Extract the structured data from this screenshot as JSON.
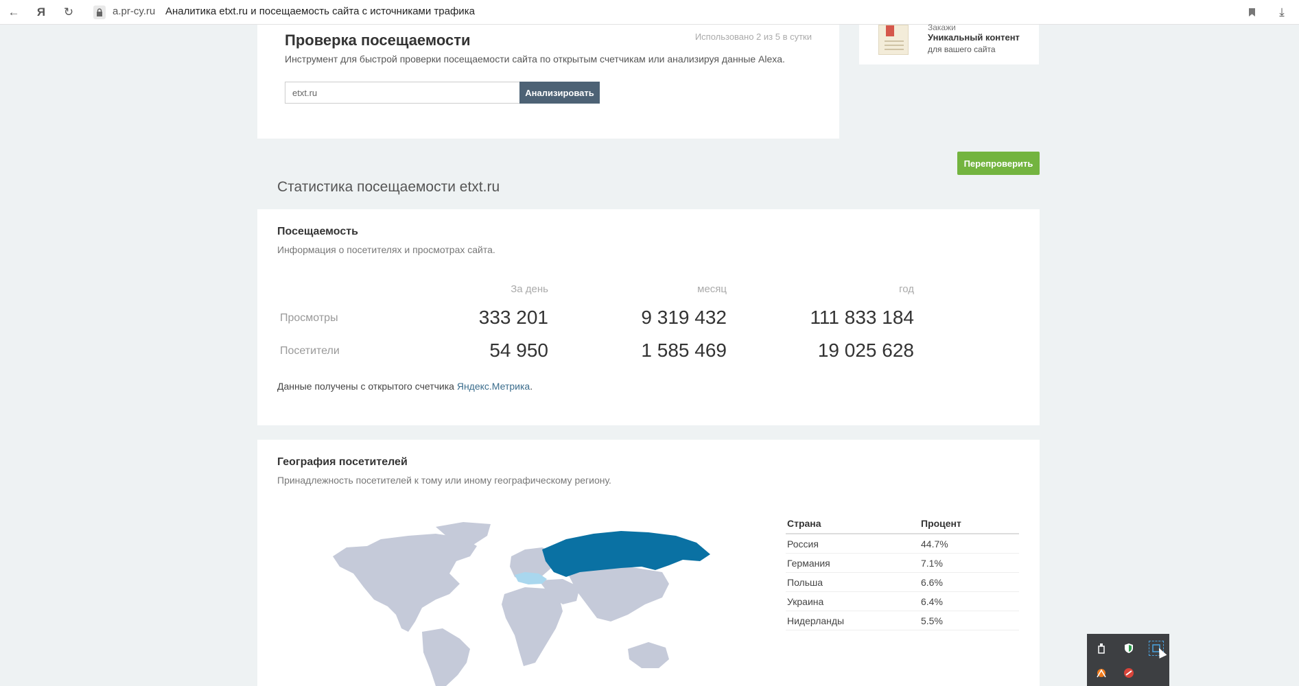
{
  "browser": {
    "domain": "a.pr-cy.ru",
    "page_title": "Аналитика etxt.ru и посещаемость сайта с источниками трафика",
    "yandex_glyph": "Я"
  },
  "check": {
    "title": "Проверка посещаемости",
    "usage": "Использовано 2 из 5 в сутки",
    "description": "Инструмент для быстрой проверки посещаемости сайта по открытым счетчикам или анализируя данные Alexa.",
    "input_value": "etxt.ru",
    "analyze_label": "Анализировать"
  },
  "ad": {
    "order_label": "Закажи",
    "bold_label": "Уникальный контент",
    "sub_label": "для вашего сайта"
  },
  "recheck_label": "Перепроверить",
  "stats_title": "Статистика посещаемости etxt.ru",
  "traffic": {
    "title": "Посещаемость",
    "subtitle": "Информация о посетителях и просмотрах сайта.",
    "columns": [
      "За день",
      "месяц",
      "год"
    ],
    "rows": [
      {
        "label": "Просмотры",
        "values": [
          "333 201",
          "9 319 432",
          "111 833 184"
        ]
      },
      {
        "label": "Посетители",
        "values": [
          "54 950",
          "1 585 469",
          "19 025 628"
        ]
      }
    ],
    "source_prefix": "Данные получены с открытого счетчика ",
    "source_link": "Яндекс.Метрика",
    "source_suffix": "."
  },
  "geo": {
    "title": "География посетителей",
    "subtitle": "Принадлежность посетителей к тому или иному географическому региону.",
    "table_headers": [
      "Страна",
      "Процент"
    ],
    "rows": [
      {
        "country": "Россия",
        "percent": "44.7%"
      },
      {
        "country": "Германия",
        "percent": "7.1%"
      },
      {
        "country": "Польша",
        "percent": "6.6%"
      },
      {
        "country": "Украина",
        "percent": "6.4%"
      },
      {
        "country": "Нидерланды",
        "percent": "5.5%"
      }
    ],
    "colors": {
      "land": "#c5cad9",
      "russia": "#0a71a3",
      "highlight": "#a9d7ee"
    }
  }
}
